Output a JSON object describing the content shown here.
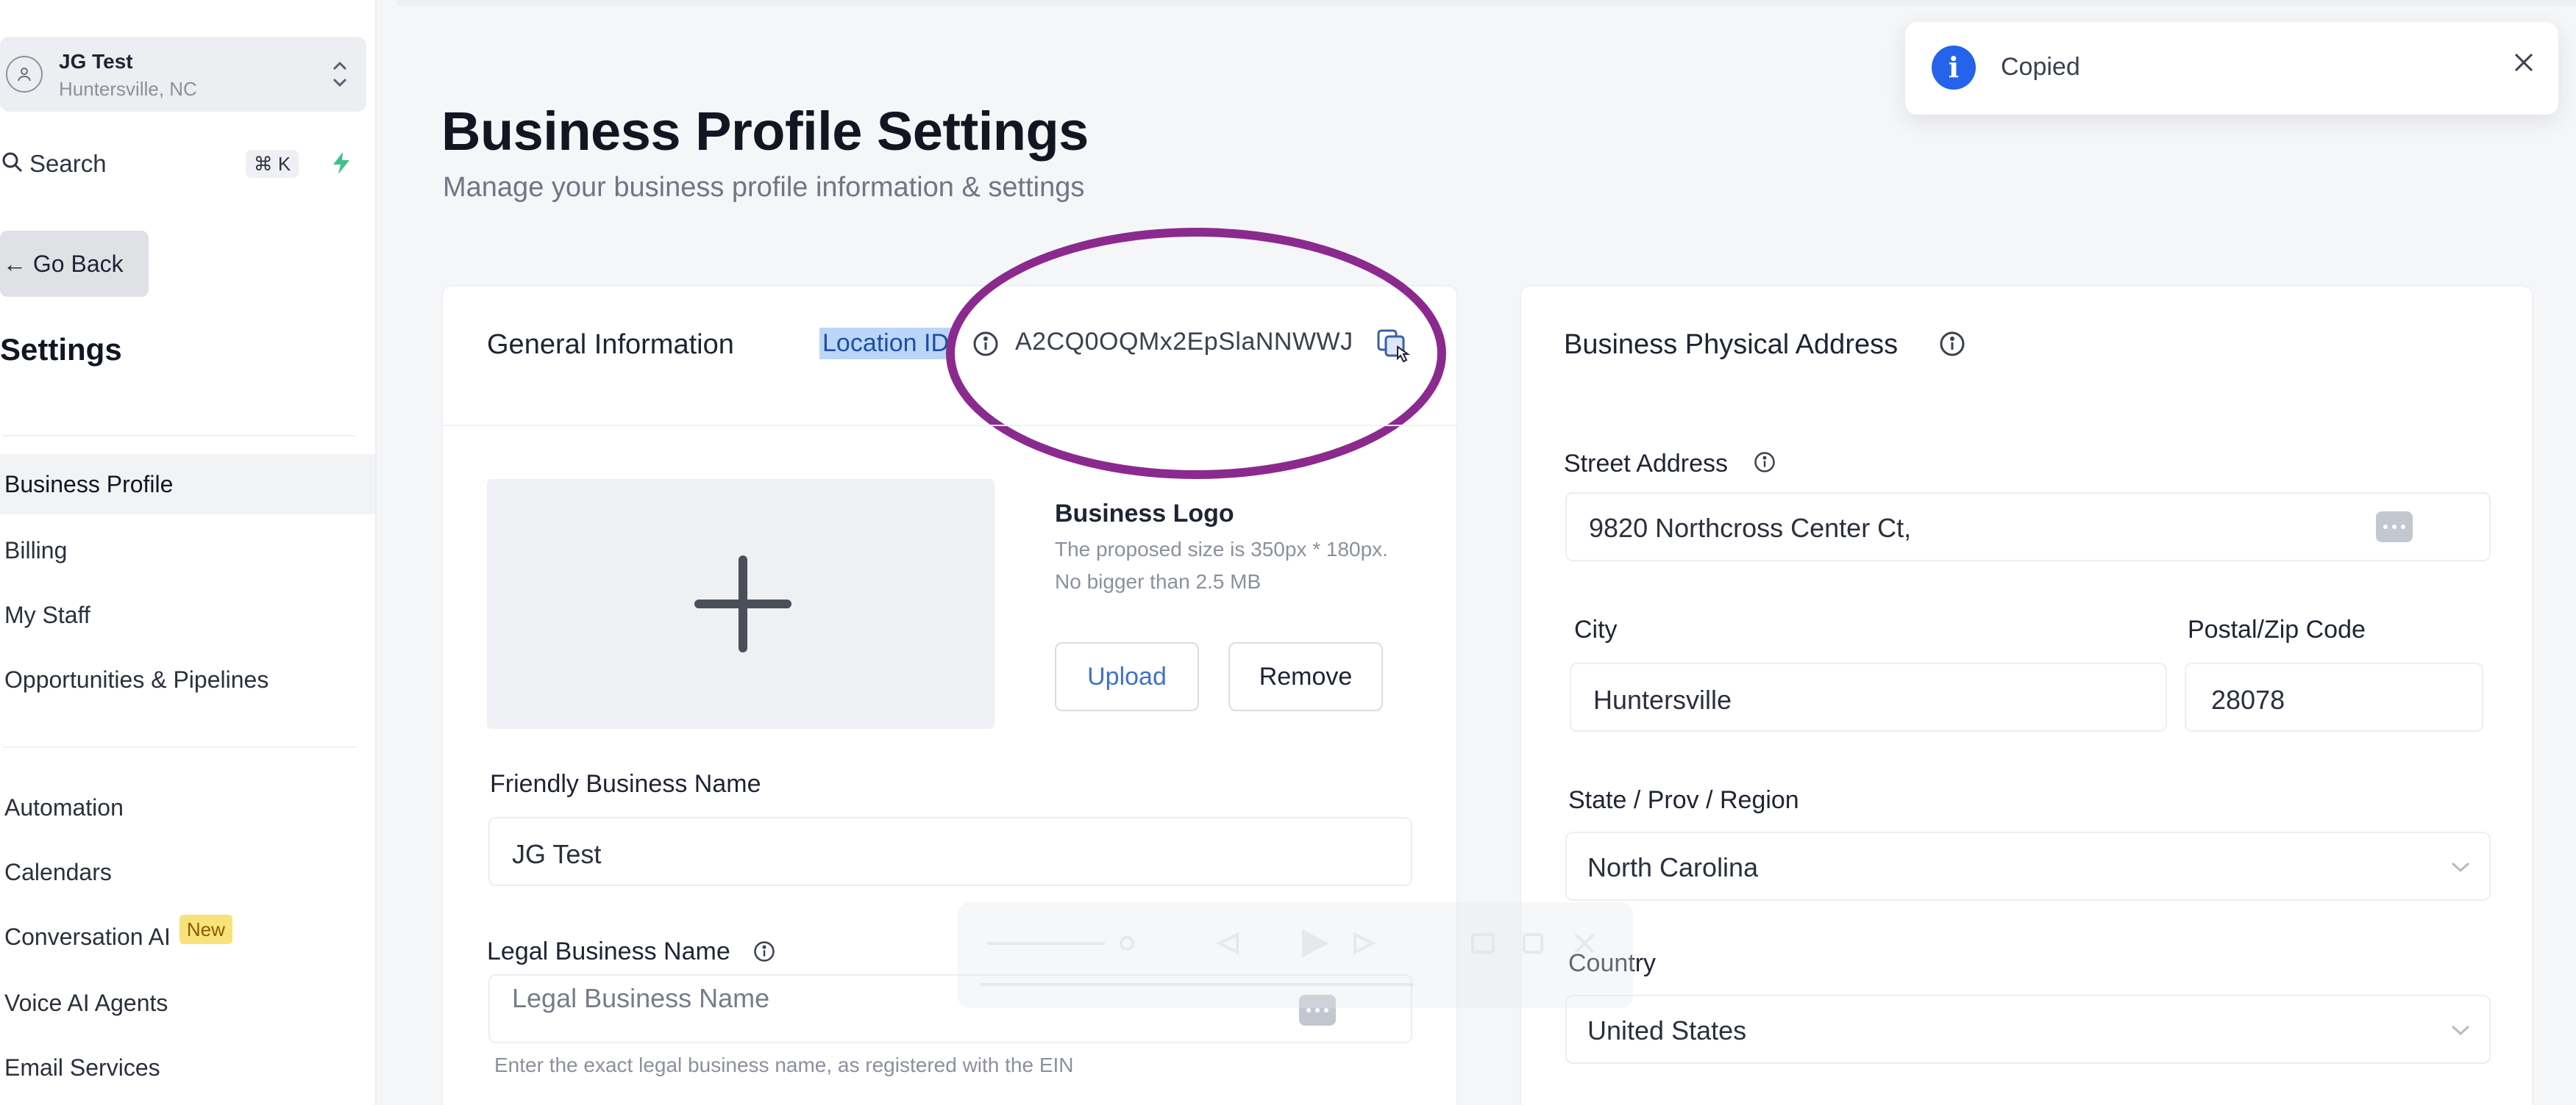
{
  "sidebar": {
    "location": {
      "name": "JG Test",
      "city": "Huntersville, NC"
    },
    "search": {
      "label": "Search",
      "shortcut": "⌘ K"
    },
    "go_back_label": "← Go Back",
    "settings_title": "Settings",
    "items": [
      {
        "label": "Business Profile",
        "active": true
      },
      {
        "label": "Billing"
      },
      {
        "label": "My Staff"
      },
      {
        "label": "Opportunities & Pipelines"
      },
      {
        "label": "Automation"
      },
      {
        "label": "Calendars"
      },
      {
        "label": "Conversation AI",
        "badge": "New"
      },
      {
        "label": "Voice AI Agents"
      },
      {
        "label": "Email Services"
      }
    ]
  },
  "toast": {
    "icon": "info-icon",
    "text": "Copied",
    "accent": "#2563eb"
  },
  "page": {
    "title": "Business Profile Settings",
    "subtitle": "Manage your business profile information & settings"
  },
  "general": {
    "title": "General Information",
    "location_id_label": "Location ID",
    "location_id_value": "A2CQ0OQMx2EpSlaNNWWJ",
    "logo": {
      "title": "Business Logo",
      "help": "The proposed size is 350px * 180px. No bigger than 2.5 MB",
      "upload_label": "Upload",
      "remove_label": "Remove"
    },
    "friendly_name": {
      "label": "Friendly Business Name",
      "value": "JG Test"
    },
    "legal_name": {
      "label": "Legal Business Name",
      "placeholder": "Legal Business Name",
      "hint": "Enter the exact legal business name, as registered with the EIN"
    }
  },
  "address": {
    "title": "Business Physical Address",
    "street": {
      "label": "Street Address",
      "value": "9820 Northcross Center Ct,"
    },
    "city": {
      "label": "City",
      "value": "Huntersville"
    },
    "postal": {
      "label": "Postal/Zip Code",
      "value": "28078"
    },
    "state": {
      "label": "State / Prov / Region",
      "value": "North Carolina"
    },
    "country": {
      "label": "Country",
      "value": "United States"
    }
  },
  "colors": {
    "highlight_ellipse": "#8b2a8e",
    "selection": "#bcd6f7",
    "badge_new": "#f8e27a"
  }
}
